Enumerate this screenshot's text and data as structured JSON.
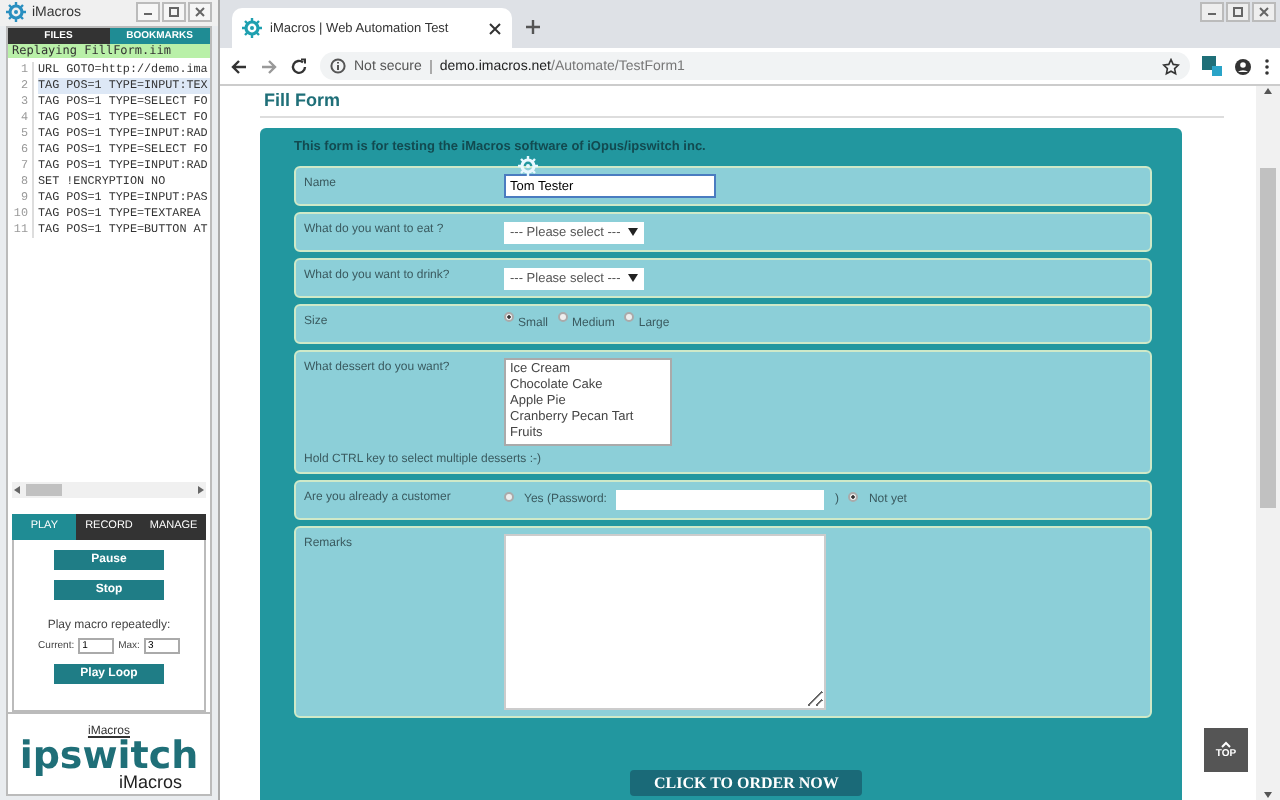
{
  "imacros": {
    "title": "iMacros",
    "file_tabs": [
      {
        "label": "FILES",
        "selected": false
      },
      {
        "label": "BOOKMARKS",
        "selected": true
      }
    ],
    "status": "Replaying FillForm.iim",
    "macro_lines": [
      {
        "number": "1",
        "code": "URL GOTO=http://demo.ima",
        "selected": false
      },
      {
        "number": "2",
        "code": "TAG POS=1 TYPE=INPUT:TEX",
        "selected": true
      },
      {
        "number": "3",
        "code": "TAG POS=1 TYPE=SELECT FO",
        "selected": false
      },
      {
        "number": "4",
        "code": "TAG POS=1 TYPE=SELECT FO",
        "selected": false
      },
      {
        "number": "5",
        "code": "TAG POS=1 TYPE=INPUT:RAD",
        "selected": false
      },
      {
        "number": "6",
        "code": "TAG POS=1 TYPE=SELECT FO",
        "selected": false
      },
      {
        "number": "7",
        "code": "TAG POS=1 TYPE=INPUT:RAD",
        "selected": false
      },
      {
        "number": "8",
        "code": "SET !ENCRYPTION NO",
        "selected": false
      },
      {
        "number": "9",
        "code": "TAG POS=1 TYPE=INPUT:PAS",
        "selected": false
      },
      {
        "number": "10",
        "code": "TAG POS=1 TYPE=TEXTAREA",
        "selected": false
      },
      {
        "number": "11",
        "code": "TAG POS=1 TYPE=BUTTON AT",
        "selected": false
      }
    ],
    "mode_tabs": [
      {
        "label": "PLAY",
        "selected": true
      },
      {
        "label": "RECORD",
        "selected": false
      },
      {
        "label": "MANAGE",
        "selected": false
      }
    ],
    "buttons": [
      "Pause",
      "Stop"
    ],
    "loop": {
      "label": "Play macro repeatedly:",
      "current_label": "Current:",
      "current": "1",
      "max_label": "Max:",
      "max": "3",
      "button": "Play Loop"
    },
    "link": "iMacros",
    "logo": {
      "brand": "ipswitch",
      "product": "iMacros"
    }
  },
  "browser": {
    "tab_title": "iMacros | Web Automation Test",
    "security": "Not secure",
    "url_host": "demo.imacros.net",
    "url_path": "/Automate/TestForm1"
  },
  "page": {
    "heading": "Fill Form",
    "intro": "This form is for testing the iMacros software of iOpus/ipswitch inc.",
    "rows": [
      {
        "kind": "text",
        "label": "Name",
        "value": "Tom Tester"
      },
      {
        "kind": "select",
        "label": "What do you want to eat ?",
        "value": "--- Please select ---"
      },
      {
        "kind": "select",
        "label": "What do you want to drink?",
        "value": "--- Please select ---"
      },
      {
        "kind": "radio",
        "label": "Size",
        "options": [
          {
            "label": "Small",
            "selected": true
          },
          {
            "label": "Medium",
            "selected": false
          },
          {
            "label": "Large",
            "selected": false
          }
        ]
      },
      {
        "kind": "list",
        "label": "What dessert do you want?",
        "options": [
          "Ice Cream",
          "Chocolate Cake",
          "Apple Pie",
          "Cranberry Pecan Tart",
          "Fruits"
        ],
        "hint": "Hold CTRL key to select multiple desserts :-)"
      },
      {
        "kind": "customer",
        "label": "Are you already a customer",
        "yes": {
          "label": "Yes (Password:",
          "selected": false
        },
        "close": ")",
        "no": {
          "label": "Not yet",
          "selected": true
        }
      },
      {
        "kind": "textarea",
        "label": "Remarks"
      }
    ],
    "submit": "CLICK TO ORDER NOW",
    "top_button": "TOP"
  }
}
